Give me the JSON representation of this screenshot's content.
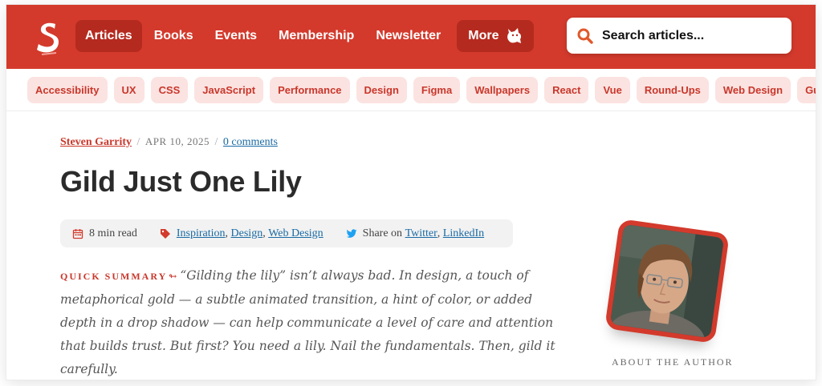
{
  "nav": {
    "items": [
      {
        "label": "Articles",
        "active": true
      },
      {
        "label": "Books",
        "active": false
      },
      {
        "label": "Events",
        "active": false
      },
      {
        "label": "Membership",
        "active": false
      },
      {
        "label": "Newsletter",
        "active": false
      }
    ],
    "more_label": "More"
  },
  "search": {
    "placeholder": "Search articles..."
  },
  "tags": [
    "Accessibility",
    "UX",
    "CSS",
    "JavaScript",
    "Performance",
    "Design",
    "Figma",
    "Wallpapers",
    "React",
    "Vue",
    "Round-Ups",
    "Web Design",
    "Gu"
  ],
  "article": {
    "author": "Steven Garrity",
    "date": "APR 10, 2025",
    "comments": "0 comments",
    "title": "Gild Just One Lily",
    "read_time": "8 min read",
    "categories": [
      "Inspiration",
      "Design",
      "Web Design"
    ],
    "share_label": "Share on",
    "share_links": [
      "Twitter",
      "LinkedIn"
    ],
    "summary_label": "QUICK SUMMARY",
    "summary_arrow": "↬",
    "summary_text": "“Gilding the lily” isn’t always bad. In design, a touch of metaphorical gold — a subtle animated transition, a hint of color, or added depth in a drop shadow — can help communicate a level of care and attention that builds trust. But first? You need a lily. Nail the fundamentals. Then, gild it carefully."
  },
  "author_box": {
    "about_label": "ABOUT THE AUTHOR"
  },
  "colors": {
    "brand": "#d33a2c",
    "brand_dark": "#b52a1f",
    "tag_bg": "#fbe3e1",
    "link": "#1a6aa3"
  }
}
